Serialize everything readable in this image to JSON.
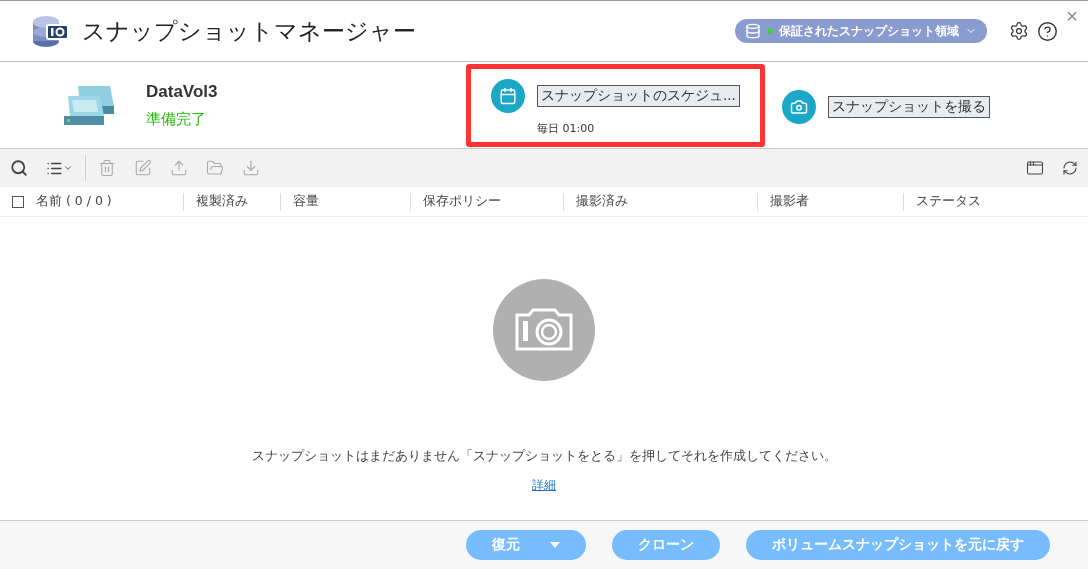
{
  "window": {
    "title": "スナップショットマネージャー",
    "close": "×"
  },
  "protection_badge": {
    "label": "保証されたスナップショット領域",
    "color": "#44cc44"
  },
  "volume": {
    "name": "DataVol3",
    "status": "準備完了"
  },
  "actions": [
    {
      "kind": "schedule",
      "label": "スナップショットのスケジュ...",
      "note": "毎日 01:00",
      "highlighted": true
    },
    {
      "kind": "take",
      "label": "スナップショットを撮る",
      "highlighted": false
    }
  ],
  "toolbar": [
    {
      "kind": "search",
      "disabled": false
    },
    {
      "kind": "list",
      "disabled": false
    },
    {
      "kind": "delete",
      "disabled": true
    },
    {
      "kind": "edit",
      "disabled": true
    },
    {
      "kind": "export",
      "disabled": true
    },
    {
      "kind": "open",
      "disabled": true
    },
    {
      "kind": "download",
      "disabled": true
    }
  ],
  "table": {
    "select_all": {
      "checked": false
    },
    "columns": [
      "名前 ( 0 / 0 )",
      "複製済み",
      "容量",
      "保存ポリシー",
      "撮影済み",
      "撮影者",
      "ステータス"
    ]
  },
  "empty_state": {
    "message": "スナップショットはまだありません「スナップショットをとる」を押してそれを作成してください。",
    "link": "詳細"
  },
  "footer_buttons": [
    {
      "label": "復元",
      "dropdown": true
    },
    {
      "label": "クローン",
      "dropdown": false
    },
    {
      "label": "ボリュームスナップショットを元に戻す",
      "dropdown": false
    }
  ]
}
